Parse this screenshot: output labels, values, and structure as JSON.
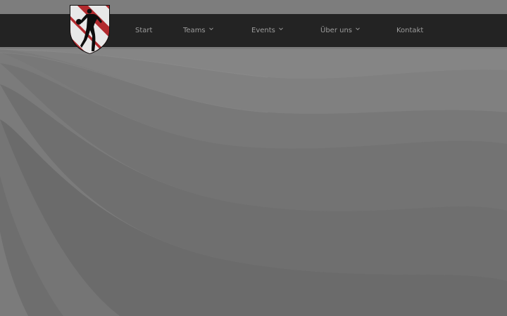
{
  "nav": {
    "items": [
      {
        "label": "Start",
        "has_dropdown": false
      },
      {
        "label": "Teams",
        "has_dropdown": true
      },
      {
        "label": "Events",
        "has_dropdown": true
      },
      {
        "label": "Über uns",
        "has_dropdown": true
      },
      {
        "label": "Kontakt",
        "has_dropdown": false
      }
    ]
  },
  "logo": {
    "icon": "handball-player-crest-icon"
  },
  "colors": {
    "navbar": "#232323",
    "nav_text": "#9c9c9c",
    "crest_red": "#b22a2e",
    "crest_white": "#e8e8e8",
    "background": "#7a7a7a"
  }
}
